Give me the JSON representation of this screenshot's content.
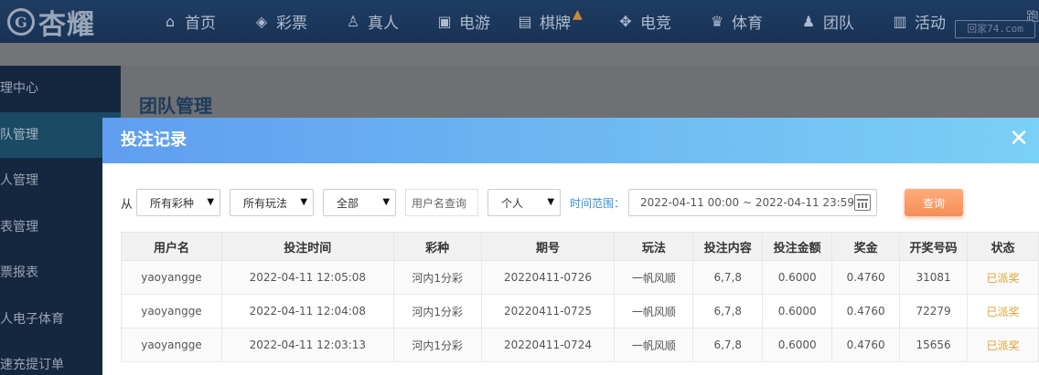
{
  "brand": {
    "badge": "G",
    "name": "杏耀"
  },
  "nav": [
    {
      "icon": "home-icon",
      "glyph": "⌂",
      "label": "首页"
    },
    {
      "icon": "lottery-ticket-icon",
      "glyph": "◈",
      "label": "彩票"
    },
    {
      "icon": "live-dealer-icon",
      "glyph": "♙",
      "label": "真人"
    },
    {
      "icon": "slot-machine-icon",
      "glyph": "▣",
      "label": "电游"
    },
    {
      "icon": "cards-icon",
      "glyph": "▤",
      "label": "棋牌"
    },
    {
      "icon": "gamepad-icon",
      "glyph": "✥",
      "label": "电竞"
    },
    {
      "icon": "trophy-icon",
      "glyph": "♛",
      "label": "体育"
    },
    {
      "icon": "team-icon",
      "glyph": "♟",
      "label": "团队"
    },
    {
      "icon": "gift-icon",
      "glyph": "▥",
      "label": "活动"
    }
  ],
  "watermark": {
    "top": "跑",
    "box": "回家74.com"
  },
  "sidebar": [
    {
      "label": "理中心"
    },
    {
      "label": "队管理"
    },
    {
      "label": "人管理"
    },
    {
      "label": "表管理"
    },
    {
      "label": "票报表"
    },
    {
      "label": "人电子体育"
    },
    {
      "label": "速充提订单"
    }
  ],
  "page_title": "团队管理",
  "modal": {
    "title": "投注记录",
    "filters": {
      "from_label": "从",
      "lottery": "所有彩种",
      "play": "所有玩法",
      "scope": "全部",
      "username_placeholder": "用户名查询",
      "type": "个人",
      "range_label": "时间范围：",
      "range_value": "2022-04-11 00:00 ~ 2022-04-11 23:59",
      "query_label": "查询"
    },
    "columns": [
      "用户名",
      "投注时间",
      "彩种",
      "期号",
      "玩法",
      "投注内容",
      "投注金额",
      "奖金",
      "开奖号码",
      "状态"
    ],
    "rows": [
      [
        "yaoyangge",
        "2022-04-11 12:05:08",
        "河内1分彩",
        "20220411-0726",
        "一帆风顺",
        "6,7,8",
        "0.6000",
        "0.4760",
        "31081",
        "已派奖"
      ],
      [
        "yaoyangge",
        "2022-04-11 12:04:08",
        "河内1分彩",
        "20220411-0725",
        "一帆风顺",
        "6,7,8",
        "0.6000",
        "0.4760",
        "72279",
        "已派奖"
      ],
      [
        "yaoyangge",
        "2022-04-11 12:03:13",
        "河内1分彩",
        "20220411-0724",
        "一帆风顺",
        "6,7,8",
        "0.6000",
        "0.4760",
        "15656",
        "已派奖"
      ]
    ]
  }
}
